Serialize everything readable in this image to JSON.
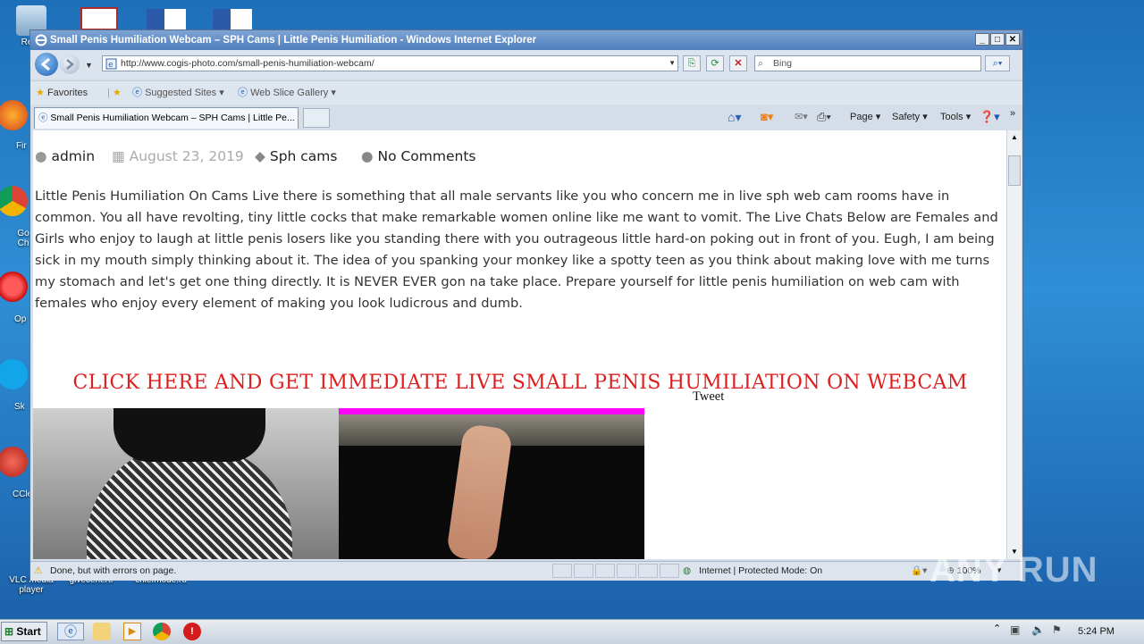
{
  "desktop": {
    "icons": [
      {
        "label": "Recy"
      },
      {
        "label": "Fir"
      },
      {
        "label": "Go Ch"
      },
      {
        "label": "Op"
      },
      {
        "label": "Sk"
      },
      {
        "label": "CCle"
      },
      {
        "label": "VLC media player"
      },
      {
        "label": "givecent.rtf"
      },
      {
        "label": "chiefmode.ru"
      }
    ],
    "watermark": "ANY RUN"
  },
  "window": {
    "title": "Small Penis Humiliation Webcam – SPH Cams | Little Penis Humiliation - Windows Internet Explorer",
    "address": "http://www.cogis-photo.com/small-penis-humiliation-webcam/",
    "search_placeholder": "Bing",
    "favorites_label": "Favorites",
    "suggested_sites": "Suggested Sites",
    "web_slice_gallery": "Web Slice Gallery",
    "tab_title": "Small Penis Humiliation Webcam – SPH Cams | Little Pe...",
    "commands": {
      "page": "Page",
      "safety": "Safety",
      "tools": "Tools"
    },
    "status_text": "Done, but with errors on page.",
    "zone_text": "Internet | Protected Mode: On",
    "zoom": "100%"
  },
  "page": {
    "author": "admin",
    "date": "August 23, 2019",
    "category": "Sph cams",
    "comments": "No Comments",
    "paragraph": "Little Penis Humiliation On Cams Live there is something that all male servants like you who concern me in live sph web cam rooms have in common. You all have revolting, tiny little cocks that make remarkable women online like me want to vomit. The Live Chats Below are Females and Girls who enjoy to laugh at little penis losers like you standing there with you outrageous little hard-on poking out in front of you. Eugh, I am being sick in my mouth simply thinking about it. The idea of you spanking your monkey like a spotty teen as you think about making love with me turns my stomach and let's get one thing directly. It is NEVER EVER gon na take place. Prepare yourself for little penis humiliation on web cam with females who enjoy every element of making you look ludicrous and dumb.",
    "cta": "CLICK HERE AND GET IMMEDIATE LIVE SMALL PENIS HUMILIATION ON WEBCAM",
    "tweet": "Tweet"
  },
  "taskbar": {
    "start": "Start",
    "clock": "5:24 PM"
  },
  "colors": {
    "cta": "#dd1f1f",
    "accent_pink": "#ff00ff"
  }
}
